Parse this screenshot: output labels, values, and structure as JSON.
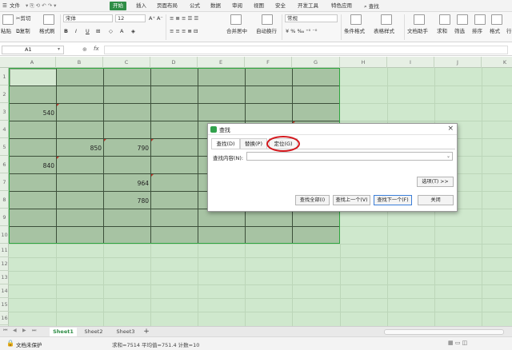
{
  "menu": {
    "file": "文件",
    "tabs": [
      "开始",
      "插入",
      "页面布局",
      "公式",
      "数据",
      "审阅",
      "视图",
      "安全",
      "开发工具",
      "特色应用"
    ],
    "active_tab": "开始",
    "search": "查找"
  },
  "ribbon": {
    "cut": "剪切",
    "paste": "粘贴",
    "copy": "复制",
    "format_painter": "格式刷",
    "font_name": "宋体",
    "font_size": "12",
    "merge_center": "合并居中",
    "auto_wrap": "自动换行",
    "number_format": "常规",
    "conditional_format": "条件格式",
    "table_style": "表格样式",
    "doc_assistant": "文档助手",
    "sum": "求和",
    "filter": "筛选",
    "sort": "排序",
    "format": "格式",
    "row_col": "行"
  },
  "formula_bar": {
    "cell_ref": "A1",
    "fx": "fx",
    "value": ""
  },
  "grid": {
    "columns": [
      "A",
      "B",
      "C",
      "D",
      "E",
      "F",
      "G",
      "H",
      "I",
      "J",
      "K"
    ],
    "rows": [
      "1",
      "2",
      "3",
      "4",
      "5",
      "6",
      "7",
      "8",
      "9",
      "10",
      "11",
      "12",
      "13",
      "14",
      "15",
      "16"
    ],
    "cells": [
      {
        "ref": "A3",
        "value": "540"
      },
      {
        "ref": "B5",
        "value": "850"
      },
      {
        "ref": "C5",
        "value": "790"
      },
      {
        "ref": "A6",
        "value": "840"
      },
      {
        "ref": "C7",
        "value": "964"
      },
      {
        "ref": "C8",
        "value": "780"
      }
    ]
  },
  "dialog": {
    "title": "查找",
    "close": "×",
    "tabs": [
      "查找(D)",
      "替换(P)",
      "定位(G)"
    ],
    "find_label": "查找内容(N):",
    "find_value": "",
    "options_button": "选项(T) >>",
    "find_all": "查找全部(I)",
    "find_prev": "查找上一个(V)",
    "find_next": "查找下一个(F)",
    "close_button": "关闭"
  },
  "sheets": {
    "tabs": [
      "Sheet1",
      "Sheet2",
      "Sheet3"
    ],
    "active": "Sheet1",
    "add": "+"
  },
  "status": {
    "protect": "文档未保护",
    "summary": "求和=7514  平均值=751.4  计数=10"
  }
}
